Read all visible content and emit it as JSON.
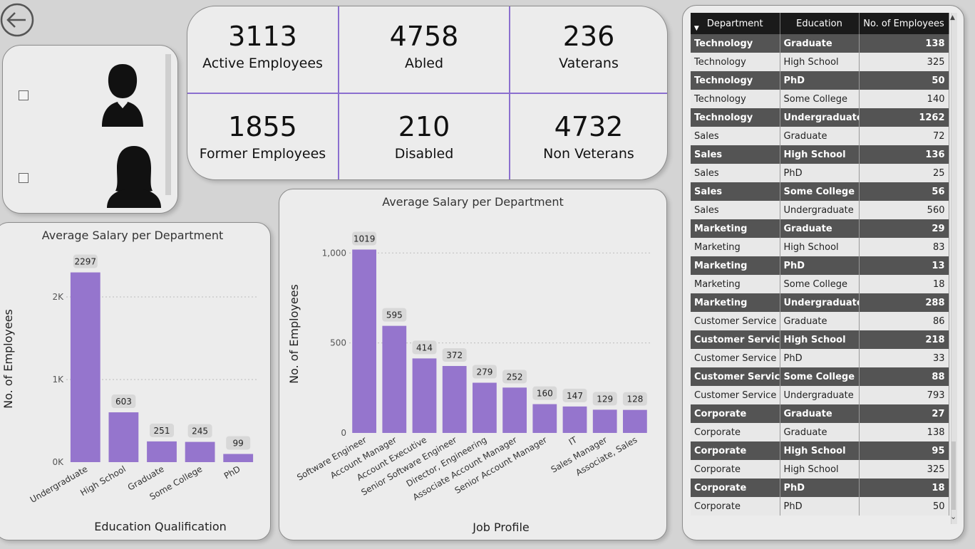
{
  "kpis": [
    {
      "value": "3113",
      "label": "Active Employees"
    },
    {
      "value": "4758",
      "label": "Abled"
    },
    {
      "value": "236",
      "label": "Vaterans"
    },
    {
      "value": "1855",
      "label": "Former Employees"
    },
    {
      "value": "210",
      "label": "Disabled"
    },
    {
      "value": "4732",
      "label": "Non Veterans"
    }
  ],
  "slicer": {
    "options": [
      {
        "icon": "male-person-icon",
        "checked": false
      },
      {
        "icon": "female-person-icon",
        "checked": false
      }
    ]
  },
  "colors": {
    "bar": "#9575cd",
    "accent_line": "#8b6fcf",
    "row_dark": "#545454",
    "row_light": "#e8e8e8",
    "header": "#1a1a1a"
  },
  "chart_data": [
    {
      "type": "bar",
      "title": "Average Salary per Department",
      "xlabel": "Education Qualification",
      "ylabel": "No. of Employees",
      "categories": [
        "Undergraduate",
        "High School",
        "Graduate",
        "Some College",
        "PhD"
      ],
      "values": [
        2297,
        603,
        251,
        245,
        99
      ],
      "ylim": [
        0,
        2500
      ],
      "yticks": [
        0,
        1000,
        2000
      ],
      "ytick_labels": [
        "0K",
        "1K",
        "2K"
      ],
      "grid": true
    },
    {
      "type": "bar",
      "title": "Average Salary per Department",
      "xlabel": "Job Profile",
      "ylabel": "No. of Employees",
      "categories": [
        "Software Engineer",
        "Account Manager",
        "Account Executive",
        "Senior Software Engineer",
        "Director, Engineering",
        "Associate Account Manager",
        "Senior Account Manager",
        "IT",
        "Sales Manager",
        "Associate, Sales"
      ],
      "values": [
        1019,
        595,
        414,
        372,
        279,
        252,
        160,
        147,
        129,
        128
      ],
      "ylim": [
        0,
        1100
      ],
      "yticks": [
        0,
        500,
        1000
      ],
      "ytick_labels": [
        "0",
        "500",
        "1,000"
      ],
      "grid": true
    }
  ],
  "table": {
    "columns": [
      "Department",
      "Education",
      "No. of Employees"
    ],
    "rows": [
      [
        "Technology",
        "Graduate",
        "138"
      ],
      [
        "Technology",
        "High School",
        "325"
      ],
      [
        "Technology",
        "PhD",
        "50"
      ],
      [
        "Technology",
        "Some College",
        "140"
      ],
      [
        "Technology",
        "Undergraduate",
        "1262"
      ],
      [
        "Sales",
        "Graduate",
        "72"
      ],
      [
        "Sales",
        "High School",
        "136"
      ],
      [
        "Sales",
        "PhD",
        "25"
      ],
      [
        "Sales",
        "Some College",
        "56"
      ],
      [
        "Sales",
        "Undergraduate",
        "560"
      ],
      [
        "Marketing",
        "Graduate",
        "29"
      ],
      [
        "Marketing",
        "High School",
        "83"
      ],
      [
        "Marketing",
        "PhD",
        "13"
      ],
      [
        "Marketing",
        "Some College",
        "18"
      ],
      [
        "Marketing",
        "Undergraduate",
        "288"
      ],
      [
        "Customer Service",
        "Graduate",
        "86"
      ],
      [
        "Customer Service",
        "High School",
        "218"
      ],
      [
        "Customer Service",
        "PhD",
        "33"
      ],
      [
        "Customer Service",
        "Some College",
        "88"
      ],
      [
        "Customer Service",
        "Undergraduate",
        "793"
      ],
      [
        "Corporate",
        "Graduate",
        "27"
      ],
      [
        "Corporate",
        "Graduate",
        "138"
      ],
      [
        "Corporate",
        "High School",
        "95"
      ],
      [
        "Corporate",
        "High School",
        "325"
      ],
      [
        "Corporate",
        "PhD",
        "18"
      ],
      [
        "Corporate",
        "PhD",
        "50"
      ]
    ]
  }
}
